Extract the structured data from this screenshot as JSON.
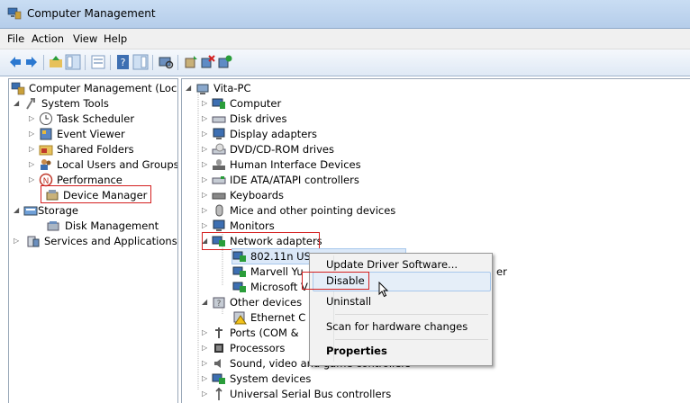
{
  "window": {
    "title": "Computer Management"
  },
  "menubar": {
    "items": [
      "File",
      "Action",
      "View",
      "Help"
    ]
  },
  "toolbar": {
    "icons": [
      "back-icon",
      "forward-icon",
      "up-icon",
      "show-hide-tree-icon",
      "view-icon",
      "help-icon",
      "show-hide-action-pane-icon",
      "scan-icon",
      "update-driver-icon",
      "uninstall-icon",
      "enable-icon"
    ]
  },
  "left_tree": {
    "root": "Computer Management (Local",
    "system_tools": "System Tools",
    "task_scheduler": "Task Scheduler",
    "event_viewer": "Event Viewer",
    "shared_folders": "Shared Folders",
    "local_users": "Local Users and Groups",
    "performance": "Performance",
    "device_manager": "Device Manager",
    "storage": "Storage",
    "disk_management": "Disk Management",
    "services": "Services and Applications"
  },
  "device_tree": {
    "root": "Vita-PC",
    "computer": "Computer",
    "disk_drives": "Disk drives",
    "display_adapters": "Display adapters",
    "dvd": "DVD/CD-ROM drives",
    "hid": "Human Interface Devices",
    "ide": "IDE ATA/ATAPI controllers",
    "keyboards": "Keyboards",
    "mice": "Mice and other pointing devices",
    "monitors": "Monitors",
    "network_adapters": "Network adapters",
    "adapter_1": "802.11n US",
    "adapter_2": "Marvell Yu",
    "adapter_2_tail": "er",
    "adapter_3": "Microsoft V",
    "other_devices": "Other devices",
    "ethernet": "Ethernet C",
    "ports": "Ports (COM &",
    "processors": "Processors",
    "sound": "Sound, video and game controllers",
    "system_devices": "System devices",
    "usb": "Universal Serial Bus controllers"
  },
  "context_menu": {
    "update": "Update Driver Software...",
    "disable": "Disable",
    "uninstall": "Uninstall",
    "scan": "Scan for hardware changes",
    "properties": "Properties"
  },
  "colors": {
    "highlight_red": "#d42020",
    "selection": "#dbe8f8"
  }
}
